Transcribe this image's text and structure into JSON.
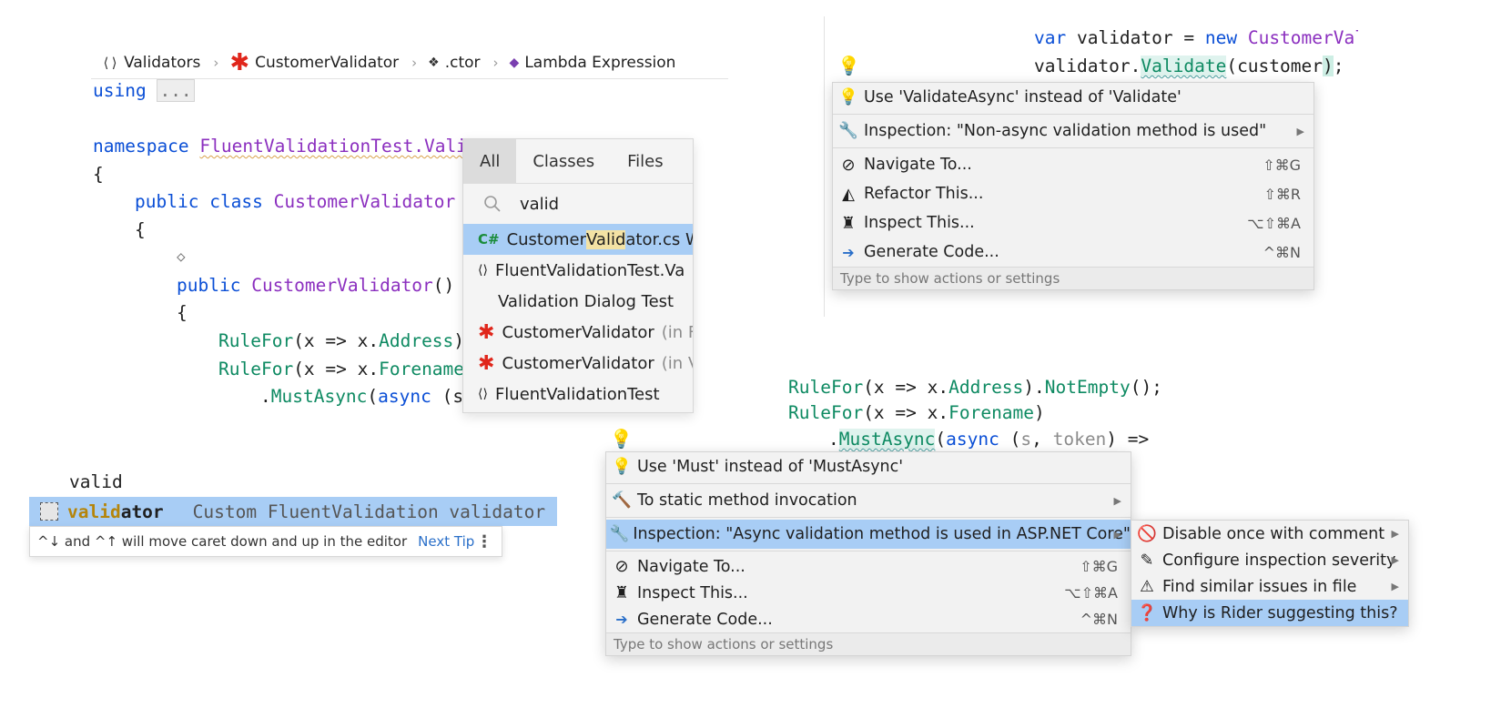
{
  "breadcrumb": {
    "items": [
      "Validators",
      "CustomerValidator",
      ".ctor",
      "Lambda Expression"
    ]
  },
  "code_left": {
    "using_kw": "using",
    "using_fold": "...",
    "namespace_kw": "namespace",
    "namespace_name": "FluentValidationTest.Vali",
    "brace_open": "{",
    "class_line": [
      "public",
      "class",
      "CustomerValidator"
    ],
    "brace_open2": "{",
    "diamond": "◇",
    "ctor_line": [
      "public",
      "CustomerValidator",
      "()"
    ],
    "brace_open3": "{",
    "rule1": [
      "RuleFor",
      "(x => x.",
      "Address",
      ")"
    ],
    "rule2": [
      "RuleFor",
      "(x => x.",
      "Forename",
      ")"
    ],
    "rule3": [
      ".",
      "MustAsync",
      "(",
      "async",
      " (s"
    ]
  },
  "search": {
    "tabs": [
      "All",
      "Classes",
      "Files"
    ],
    "query": "valid",
    "results": [
      {
        "icon": "C#",
        "pre": "Customer",
        "hl": "Valid",
        "post": "ator.cs W",
        "extra": ""
      },
      {
        "icon": "⟨⟩",
        "pre": "FluentValidationTest.Va",
        "hl": "",
        "post": "",
        "extra": ""
      },
      {
        "icon": "",
        "pre": "Validation Dialog Test",
        "hl": "",
        "post": "",
        "extra": ""
      },
      {
        "icon": "✱",
        "pre": "CustomerValidator",
        "hl": "",
        "post": "",
        "extra": "(in F"
      },
      {
        "icon": "✱",
        "pre": "CustomerValidator",
        "hl": "",
        "post": "",
        "extra": "(in V"
      },
      {
        "icon": "⟨⟩",
        "pre": "FluentValidationTest",
        "hl": "",
        "post": "",
        "extra": ""
      }
    ]
  },
  "code_tr": {
    "line1": [
      "var",
      " validator = ",
      "new",
      " CustomerVal"
    ],
    "line2": [
      "validator.",
      "Validate",
      "(customer",
      ")",
      ";"
    ]
  },
  "menu_tr": {
    "items": [
      {
        "label": "Use 'ValidateAsync' instead of 'Validate'",
        "shortcut": "",
        "arrow": false
      },
      {
        "label": "Inspection: \"Non-async validation method is used\"",
        "shortcut": "",
        "arrow": true
      },
      {
        "label": "Navigate To...",
        "shortcut": "⇧⌘G",
        "arrow": false
      },
      {
        "label": "Refactor This...",
        "shortcut": "⇧⌘R",
        "arrow": false
      },
      {
        "label": "Inspect This...",
        "shortcut": "⌥⇧⌘A",
        "arrow": false
      },
      {
        "label": "Generate Code...",
        "shortcut": "^⌘N",
        "arrow": false
      }
    ],
    "footer": "Type to show actions or settings"
  },
  "code_br": {
    "line1": [
      "RuleFor",
      "(x => x.",
      "Address",
      ").",
      "NotEmpty",
      "();"
    ],
    "line2": [
      "RuleFor",
      "(x => x.",
      "Forename",
      ")"
    ],
    "line3": [
      ".",
      "MustAsync",
      "(",
      "async",
      " (",
      "s",
      ", ",
      "token",
      ") =>"
    ]
  },
  "menu_br": {
    "items": [
      {
        "label": "Use 'Must' instead of 'MustAsync'",
        "shortcut": "",
        "arrow": false
      },
      {
        "label": "To static method invocation",
        "shortcut": "",
        "arrow": true
      },
      {
        "label": "Inspection: \"Async validation method is used in ASP.NET Core\"",
        "shortcut": "",
        "arrow": true
      },
      {
        "label": "Navigate To...",
        "shortcut": "⇧⌘G",
        "arrow": false
      },
      {
        "label": "Inspect This...",
        "shortcut": "⌥⇧⌘A",
        "arrow": false
      },
      {
        "label": "Generate Code...",
        "shortcut": "^⌘N",
        "arrow": false
      }
    ],
    "footer": "Type to show actions or settings"
  },
  "submenu": {
    "items": [
      {
        "label": "Disable once with comment",
        "arrow": true
      },
      {
        "label": "Configure inspection severity",
        "arrow": true
      },
      {
        "label": "Find similar issues in file",
        "arrow": true
      },
      {
        "label": "Why is Rider suggesting this?",
        "arrow": false
      }
    ]
  },
  "completion": {
    "typed": "valid",
    "match": "valid",
    "rest": "ator",
    "description": "Custom FluentValidation validator",
    "tip": "^↓ and ^↑ will move caret down and up in the editor",
    "next_tip": "Next Tip"
  },
  "colors": {
    "selection": "#a8cdf5",
    "keyword": "#0b4fd6",
    "type": "#8b2fbf",
    "method": "#0e8a62"
  }
}
